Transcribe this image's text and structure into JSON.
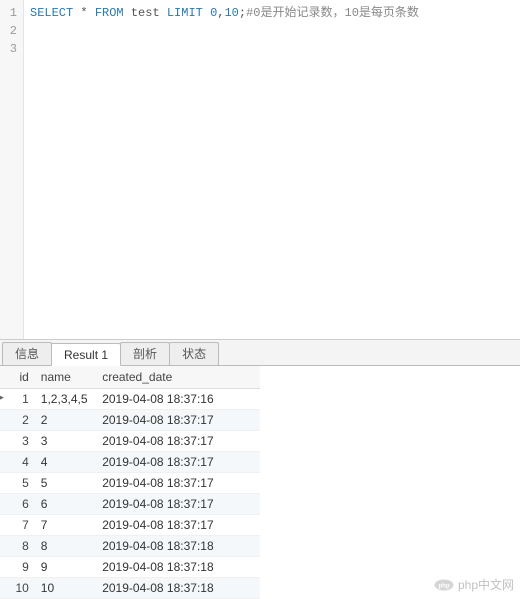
{
  "editor": {
    "lines": [
      1,
      2,
      3
    ],
    "sql": {
      "kw_select": "SELECT",
      "star": "*",
      "kw_from": "FROM",
      "table": "test",
      "kw_limit": "LIMIT",
      "args": "0",
      "comma": ",",
      "args2": "10",
      "semi": ";",
      "comment": "#0是开始记录数，10是每页条数"
    }
  },
  "tabs": {
    "items": [
      {
        "label": "信息",
        "active": false
      },
      {
        "label": "Result 1",
        "active": true
      },
      {
        "label": "剖析",
        "active": false
      },
      {
        "label": "状态",
        "active": false
      }
    ]
  },
  "result": {
    "columns": [
      "id",
      "name",
      "created_date"
    ],
    "rows": [
      {
        "id": 1,
        "name": "1,2,3,4,5",
        "created_date": "2019-04-08 18:37:16"
      },
      {
        "id": 2,
        "name": "2",
        "created_date": "2019-04-08 18:37:17"
      },
      {
        "id": 3,
        "name": "3",
        "created_date": "2019-04-08 18:37:17"
      },
      {
        "id": 4,
        "name": "4",
        "created_date": "2019-04-08 18:37:17"
      },
      {
        "id": 5,
        "name": "5",
        "created_date": "2019-04-08 18:37:17"
      },
      {
        "id": 6,
        "name": "6",
        "created_date": "2019-04-08 18:37:17"
      },
      {
        "id": 7,
        "name": "7",
        "created_date": "2019-04-08 18:37:17"
      },
      {
        "id": 8,
        "name": "8",
        "created_date": "2019-04-08 18:37:18"
      },
      {
        "id": 9,
        "name": "9",
        "created_date": "2019-04-08 18:37:18"
      },
      {
        "id": 10,
        "name": "10",
        "created_date": "2019-04-08 18:37:18"
      }
    ],
    "selected_row_index": 0
  },
  "watermark": {
    "text": "php中文网"
  }
}
